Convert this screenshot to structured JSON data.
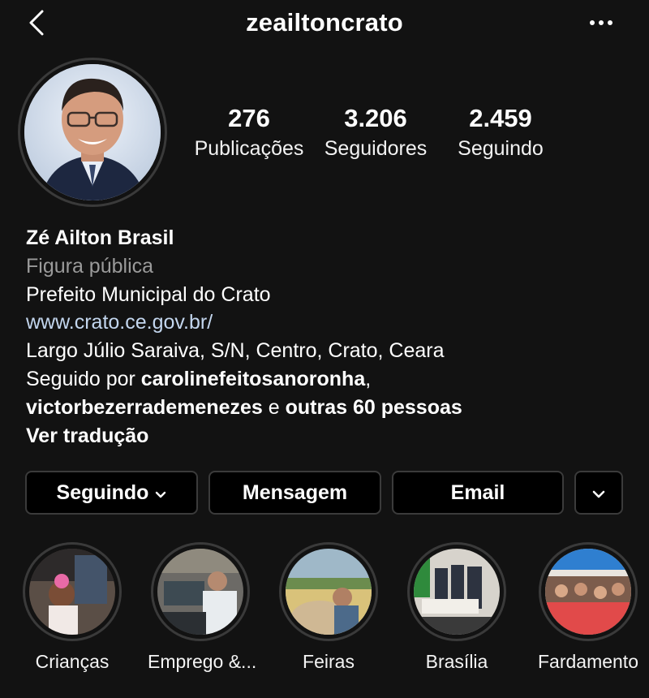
{
  "header": {
    "username": "zeailtoncrato"
  },
  "stats": [
    {
      "value": "276",
      "label": "Publicações"
    },
    {
      "value": "3.206",
      "label": "Seguidores"
    },
    {
      "value": "2.459",
      "label": "Seguindo"
    }
  ],
  "bio": {
    "name": "Zé Ailton Brasil",
    "category": "Figura pública",
    "description": "Prefeito Municipal do Crato",
    "website": "www.crato.ce.gov.br/",
    "address": "Largo Júlio Saraiva, S/N, Centro, Crato, Ceara",
    "followed_by_prefix": "Seguido por ",
    "followed_by_user1": "carolinefeitosanoronha",
    "followed_by_comma": ",",
    "followed_by_user2": "victorbezerrademenezes",
    "followed_by_and": " e ",
    "followed_by_others": "outras 60 pessoas",
    "translate": "Ver tradução"
  },
  "actions": {
    "following": "Seguindo",
    "message": "Mensagem",
    "email": "Email"
  },
  "highlights": [
    {
      "label": "Crianças"
    },
    {
      "label": "Emprego &..."
    },
    {
      "label": "Feiras"
    },
    {
      "label": "Brasília"
    },
    {
      "label": "Fardamento"
    }
  ],
  "icons": {
    "back": "chevron-left-icon",
    "more": "more-horizontal-icon",
    "dropdown": "chevron-down-icon"
  }
}
